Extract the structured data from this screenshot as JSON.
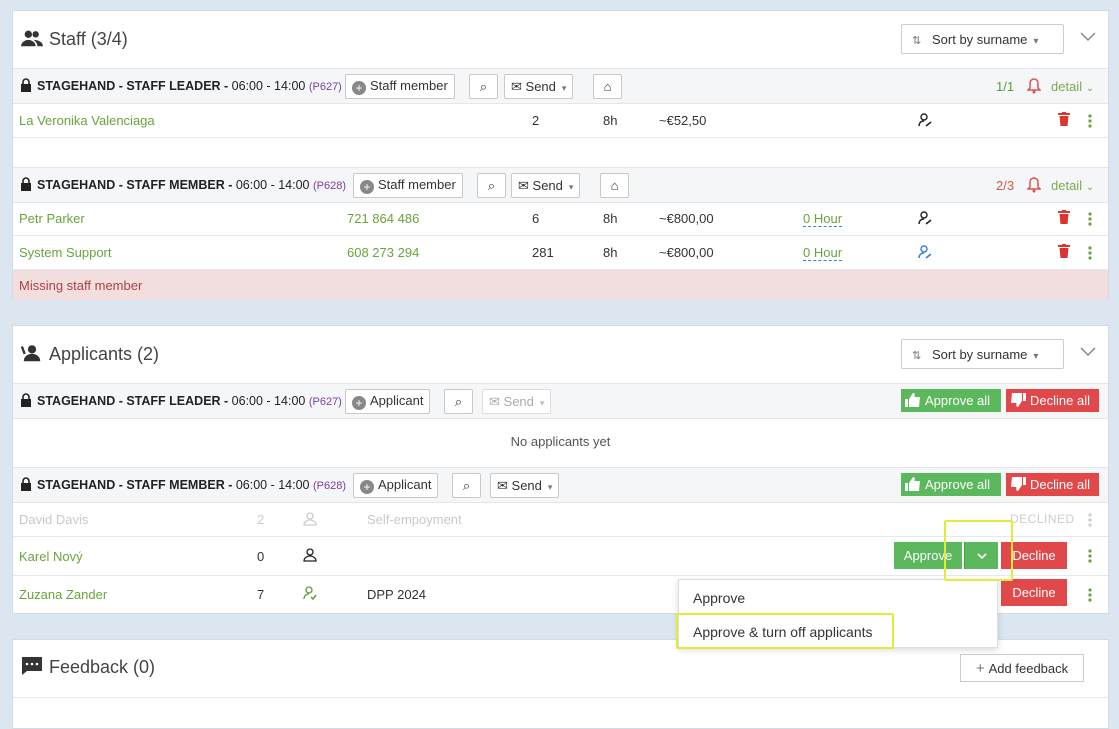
{
  "staff": {
    "title": "Staff (3/4)",
    "sort_label": "Sort by surname",
    "groups": [
      {
        "role": "STAGEHAND - STAFF LEADER",
        "time": "06:00 - 14:00",
        "code": "(P627)",
        "add_label": "Staff member",
        "send_label": "Send",
        "count": "1/1",
        "detail_label": "detail",
        "rows": [
          {
            "name": "La Veronika Valenciaga",
            "phone": "",
            "num": "2",
            "hours": "8h",
            "amount": "~€52,50",
            "hour_link": ""
          }
        ]
      },
      {
        "role": "STAGEHAND - STAFF MEMBER",
        "time": "06:00 - 14:00",
        "code": "(P628)",
        "add_label": "Staff member",
        "send_label": "Send",
        "count": "2/3",
        "detail_label": "detail",
        "rows": [
          {
            "name": "Petr Parker",
            "phone": "721 864 486",
            "num": "6",
            "hours": "8h",
            "amount": "~€800,00",
            "hour_link": "0 Hour"
          },
          {
            "name": "System Support",
            "phone": "608 273 294",
            "num": "281",
            "hours": "8h",
            "amount": "~€800,00",
            "hour_link": "0 Hour"
          }
        ],
        "missing": "Missing staff member"
      }
    ]
  },
  "applicants": {
    "title": "Applicants (2)",
    "sort_label": "Sort by surname",
    "approve_all_label": "Approve all",
    "decline_all_label": "Decline all",
    "groups": [
      {
        "role": "STAGEHAND - STAFF LEADER",
        "time": "06:00 - 14:00",
        "code": "(P627)",
        "add_label": "Applicant",
        "send_label": "Send",
        "empty": "No applicants yet"
      },
      {
        "role": "STAGEHAND - STAFF MEMBER",
        "time": "06:00 - 14:00",
        "code": "(P628)",
        "add_label": "Applicant",
        "send_label": "Send",
        "rows": [
          {
            "name": "David Davis",
            "num": "2",
            "contract": "Self-empoyment",
            "status": "DECLINED"
          },
          {
            "name": "Karel Nový",
            "num": "0",
            "contract": "",
            "approve_label": "Approve",
            "decline_label": "Decline"
          },
          {
            "name": "Zuzana Zander",
            "num": "7",
            "contract": "DPP 2024",
            "decline_label": "Decline"
          }
        ]
      }
    ]
  },
  "dropdown": {
    "items": [
      "Approve",
      "Approve & turn off applicants"
    ]
  },
  "feedback": {
    "title": "Feedback (0)",
    "add_label": "Add feedback"
  },
  "colors": {
    "accent_green": "#5cb85c",
    "danger_red": "#e0484a",
    "highlight": "#e2ea3a"
  }
}
